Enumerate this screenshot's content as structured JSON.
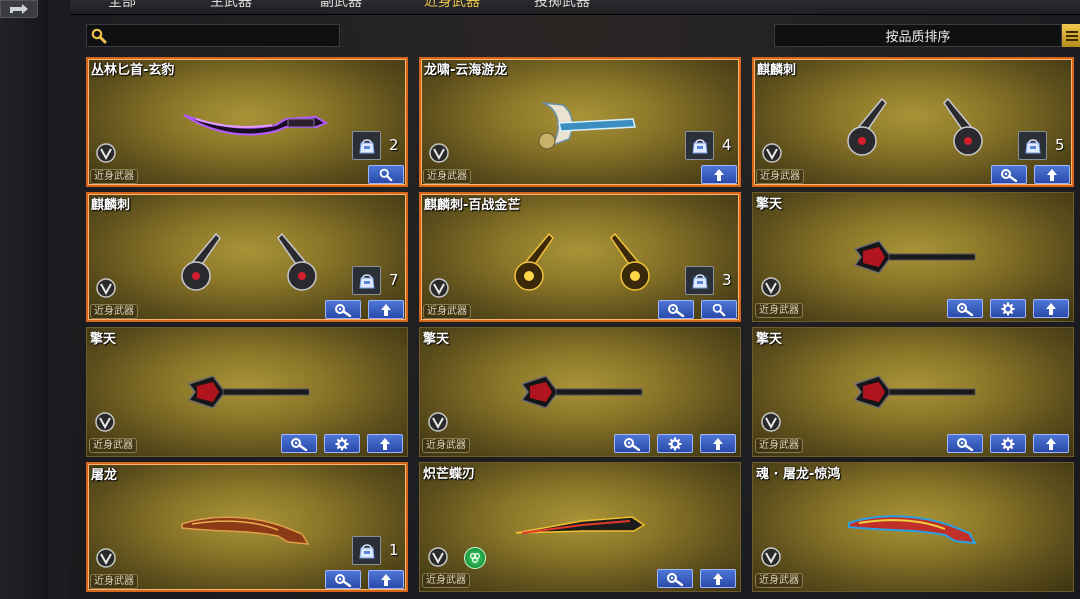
{
  "tabs": [
    {
      "label": "全部",
      "active": false
    },
    {
      "label": "主武器",
      "active": false
    },
    {
      "label": "副武器",
      "active": false
    },
    {
      "label": "近身武器",
      "active": true
    },
    {
      "label": "投掷武器",
      "active": false
    }
  ],
  "search": {
    "value": ""
  },
  "sort": {
    "label": "按品质排序"
  },
  "colors": {
    "selected_border": "#d4661c",
    "active_tab": "#e9c24a",
    "button_blue": "#2a4aa8"
  },
  "cards": [
    {
      "title": "丛林匕首-玄豹",
      "category": "近身武器",
      "count": "2",
      "weapon": "purple-dagger",
      "buttons": [
        "search"
      ]
    },
    {
      "title": "龙啸-云海游龙",
      "category": "近身武器",
      "count": "4",
      "weapon": "dragon-axe",
      "buttons": [
        "upgrade"
      ]
    },
    {
      "title": "麒麟刺",
      "category": "近身武器",
      "count": "5",
      "weapon": "qilin-silver",
      "buttons": [
        "wrench",
        "upgrade"
      ]
    },
    {
      "title": "麒麟刺",
      "category": "近身武器",
      "count": "7",
      "weapon": "qilin-silver",
      "buttons": [
        "wrench",
        "upgrade"
      ]
    },
    {
      "title": "麒麟刺-百战金芒",
      "category": "近身武器",
      "count": "3",
      "weapon": "qilin-gold",
      "buttons": [
        "wrench",
        "search"
      ]
    },
    {
      "title": "擎天",
      "category": "近身武器",
      "count": "",
      "weapon": "qingtian",
      "buttons": [
        "wrench",
        "gear",
        "upgrade"
      ]
    },
    {
      "title": "擎天",
      "category": "近身武器",
      "count": "",
      "weapon": "qingtian",
      "buttons": [
        "wrench",
        "gear",
        "upgrade"
      ]
    },
    {
      "title": "擎天",
      "category": "近身武器",
      "count": "",
      "weapon": "qingtian",
      "buttons": [
        "wrench",
        "gear",
        "upgrade"
      ]
    },
    {
      "title": "擎天",
      "category": "近身武器",
      "count": "",
      "weapon": "qingtian",
      "buttons": [
        "wrench",
        "gear",
        "upgrade"
      ]
    },
    {
      "title": "屠龙",
      "category": "近身武器",
      "count": "1",
      "weapon": "tulong",
      "buttons": [
        "wrench",
        "upgrade"
      ]
    },
    {
      "title": "炽芒蝶刃",
      "category": "近身武器",
      "count": "",
      "weapon": "butterfly",
      "buttons": [
        "wrench",
        "upgrade"
      ],
      "badge": "green-rune-icon"
    },
    {
      "title": "魂 · 屠龙-惊鸿",
      "category": "近身武器",
      "count": "",
      "weapon": "tulong-jinghong",
      "buttons": []
    }
  ]
}
